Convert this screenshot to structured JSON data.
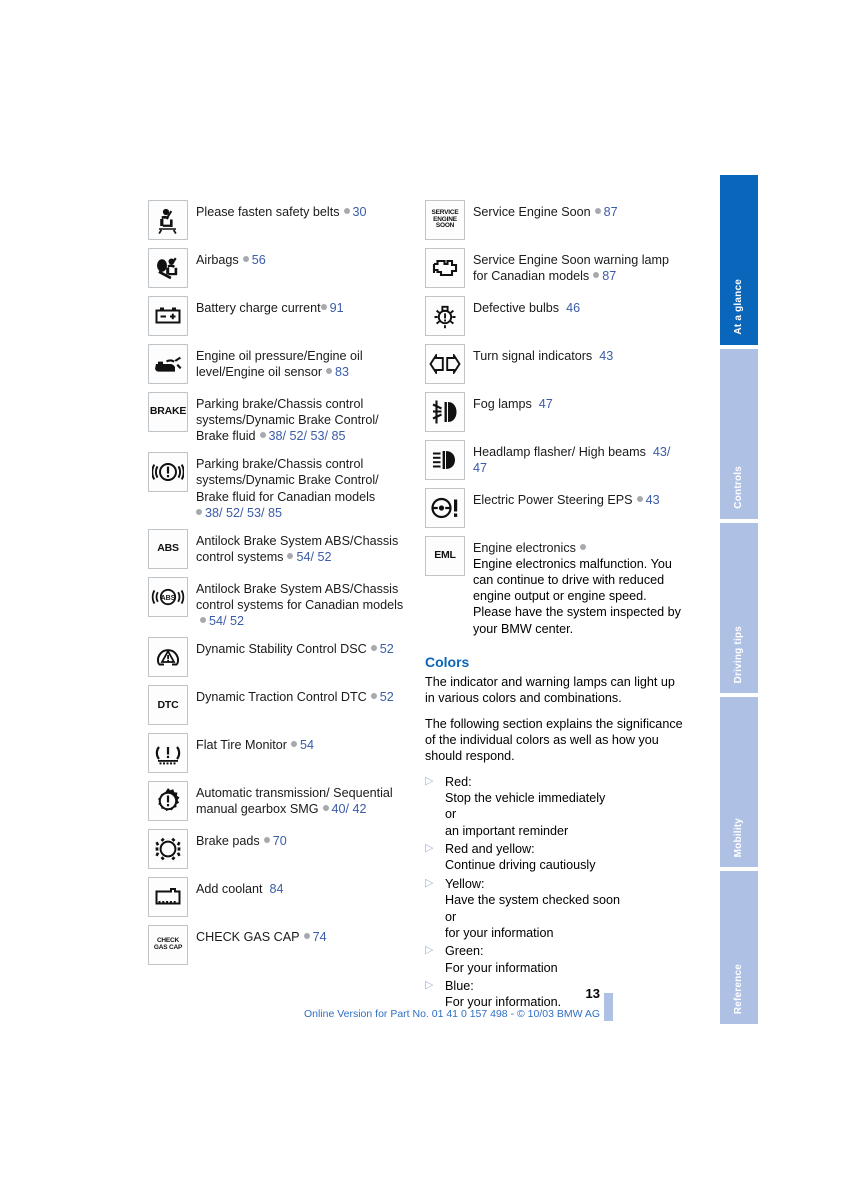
{
  "document": {
    "page_number": "13",
    "footer": "Online Version for Part No. 01 41 0 157 498 - © 10/03 BMW AG"
  },
  "tabs": [
    {
      "label": "At a glance",
      "state": "active"
    },
    {
      "label": "Controls",
      "state": "inactive"
    },
    {
      "label": "Driving tips",
      "state": "inactive"
    },
    {
      "label": "Mobility",
      "state": "inactive"
    },
    {
      "label": "Reference",
      "state": "inactive"
    }
  ],
  "left_column": [
    {
      "icon": "seatbelt-icon",
      "icon_label": "",
      "text": "Please fasten safety belts",
      "separator": true,
      "refs": "30"
    },
    {
      "icon": "airbag-icon",
      "icon_label": "",
      "text": "Airbags",
      "separator": true,
      "refs": "56"
    },
    {
      "icon": "battery-icon",
      "icon_label": "",
      "text": "Battery charge current",
      "separator": true,
      "refs": "91"
    },
    {
      "icon": "oil-can-icon",
      "icon_label": "",
      "text": "Engine oil pressure/Engine oil level/Engine oil sensor",
      "separator": true,
      "refs": "83"
    },
    {
      "icon": "brake-text-icon",
      "icon_label": "BRAKE",
      "text": "Parking brake/Chassis control systems/Dynamic Brake Control/ Brake fluid",
      "separator": true,
      "refs": "38/ 52/ 53/ 85"
    },
    {
      "icon": "brake-circle-icon",
      "icon_label": "",
      "text": "Parking brake/Chassis control systems/Dynamic Brake Control/ Brake fluid for Canadian models",
      "separator": true,
      "refs": "38/ 52/ 53/ 85"
    },
    {
      "icon": "abs-text-icon",
      "icon_label": "ABS",
      "text": "Antilock Brake System ABS/Chassis control systems",
      "separator": true,
      "refs": "54/ 52"
    },
    {
      "icon": "abs-circle-icon",
      "icon_label": "ABS",
      "text": "Antilock Brake System ABS/Chassis control systems for Canadian models",
      "separator": true,
      "refs": "54/ 52"
    },
    {
      "icon": "dsc-icon",
      "icon_label": "",
      "text": "Dynamic Stability Control DSC",
      "separator": true,
      "refs": "52"
    },
    {
      "icon": "dtc-text-icon",
      "icon_label": "DTC",
      "text": "Dynamic Traction Control DTC",
      "separator": true,
      "refs": "52"
    },
    {
      "icon": "flat-tire-icon",
      "icon_label": "",
      "text": "Flat Tire Monitor",
      "separator": true,
      "refs": "54"
    },
    {
      "icon": "transmission-icon",
      "icon_label": "",
      "text": "Automatic transmission/ Sequential manual gearbox SMG",
      "separator": true,
      "refs": "40/ 42"
    },
    {
      "icon": "brake-pads-icon",
      "icon_label": "",
      "text": "Brake pads",
      "separator": true,
      "refs": "70"
    },
    {
      "icon": "coolant-icon",
      "icon_label": "",
      "text": "Add coolant",
      "separator": false,
      "refs": "84"
    },
    {
      "icon": "check-gas-cap-icon",
      "icon_label": "CHECK GAS CAP",
      "text": "CHECK GAS CAP",
      "separator": true,
      "refs": "74"
    }
  ],
  "right_column": [
    {
      "icon": "service-engine-soon-text-icon",
      "icon_label": "SERVICE ENGINE SOON",
      "text": "Service Engine Soon",
      "separator": true,
      "refs": "87"
    },
    {
      "icon": "engine-outline-icon",
      "icon_label": "",
      "text": "Service Engine Soon warning lamp for Canadian models",
      "separator": true,
      "refs": "87"
    },
    {
      "icon": "defective-bulb-icon",
      "icon_label": "",
      "text": "Defective bulbs",
      "separator": false,
      "refs": "46"
    },
    {
      "icon": "turn-signal-icon",
      "icon_label": "",
      "text": "Turn signal indicators",
      "separator": false,
      "refs": "43"
    },
    {
      "icon": "fog-lamp-icon",
      "icon_label": "",
      "text": "Fog lamps",
      "separator": false,
      "refs": "47"
    },
    {
      "icon": "high-beam-icon",
      "icon_label": "",
      "text": "Headlamp flasher/ High beams",
      "separator": false,
      "refs": "43/ 47"
    },
    {
      "icon": "eps-steering-icon",
      "icon_label": "",
      "text": "Electric Power Steering EPS",
      "separator": true,
      "refs": "43"
    },
    {
      "icon": "eml-text-icon",
      "icon_label": "EML",
      "text": "Engine electronics",
      "separator": true,
      "refs": "",
      "note": "Engine electronics malfunction. You can continue to drive with reduced engine output or engine speed. Please have the system inspected by your BMW center."
    }
  ],
  "colors_section": {
    "title": "Colors",
    "paragraphs": [
      "The indicator and warning lamps can light up in various colors and combinations.",
      "The following section explains the significance of the individual colors as well as how you should respond."
    ],
    "items": [
      {
        "marker": "▷",
        "lines": "Red:\nStop the vehicle immediately\nor\nan important reminder"
      },
      {
        "marker": "▷",
        "lines": "Red and yellow:\nContinue driving cautiously"
      },
      {
        "marker": "▷",
        "lines": "Yellow:\nHave the system checked soon\nor\nfor your information"
      },
      {
        "marker": "▷",
        "lines": "Green:\nFor your information"
      },
      {
        "marker": "▷",
        "lines": "Blue:\nFor your information."
      }
    ]
  },
  "colors": {
    "tab_active": "#0a66ba",
    "tab_inactive": "#aec0e4",
    "reference_blue": "#3a5ba8",
    "heading_blue": "#0a66ba",
    "footer_blue": "#2f6fc4",
    "separator_dot": "#a6a9ad"
  }
}
